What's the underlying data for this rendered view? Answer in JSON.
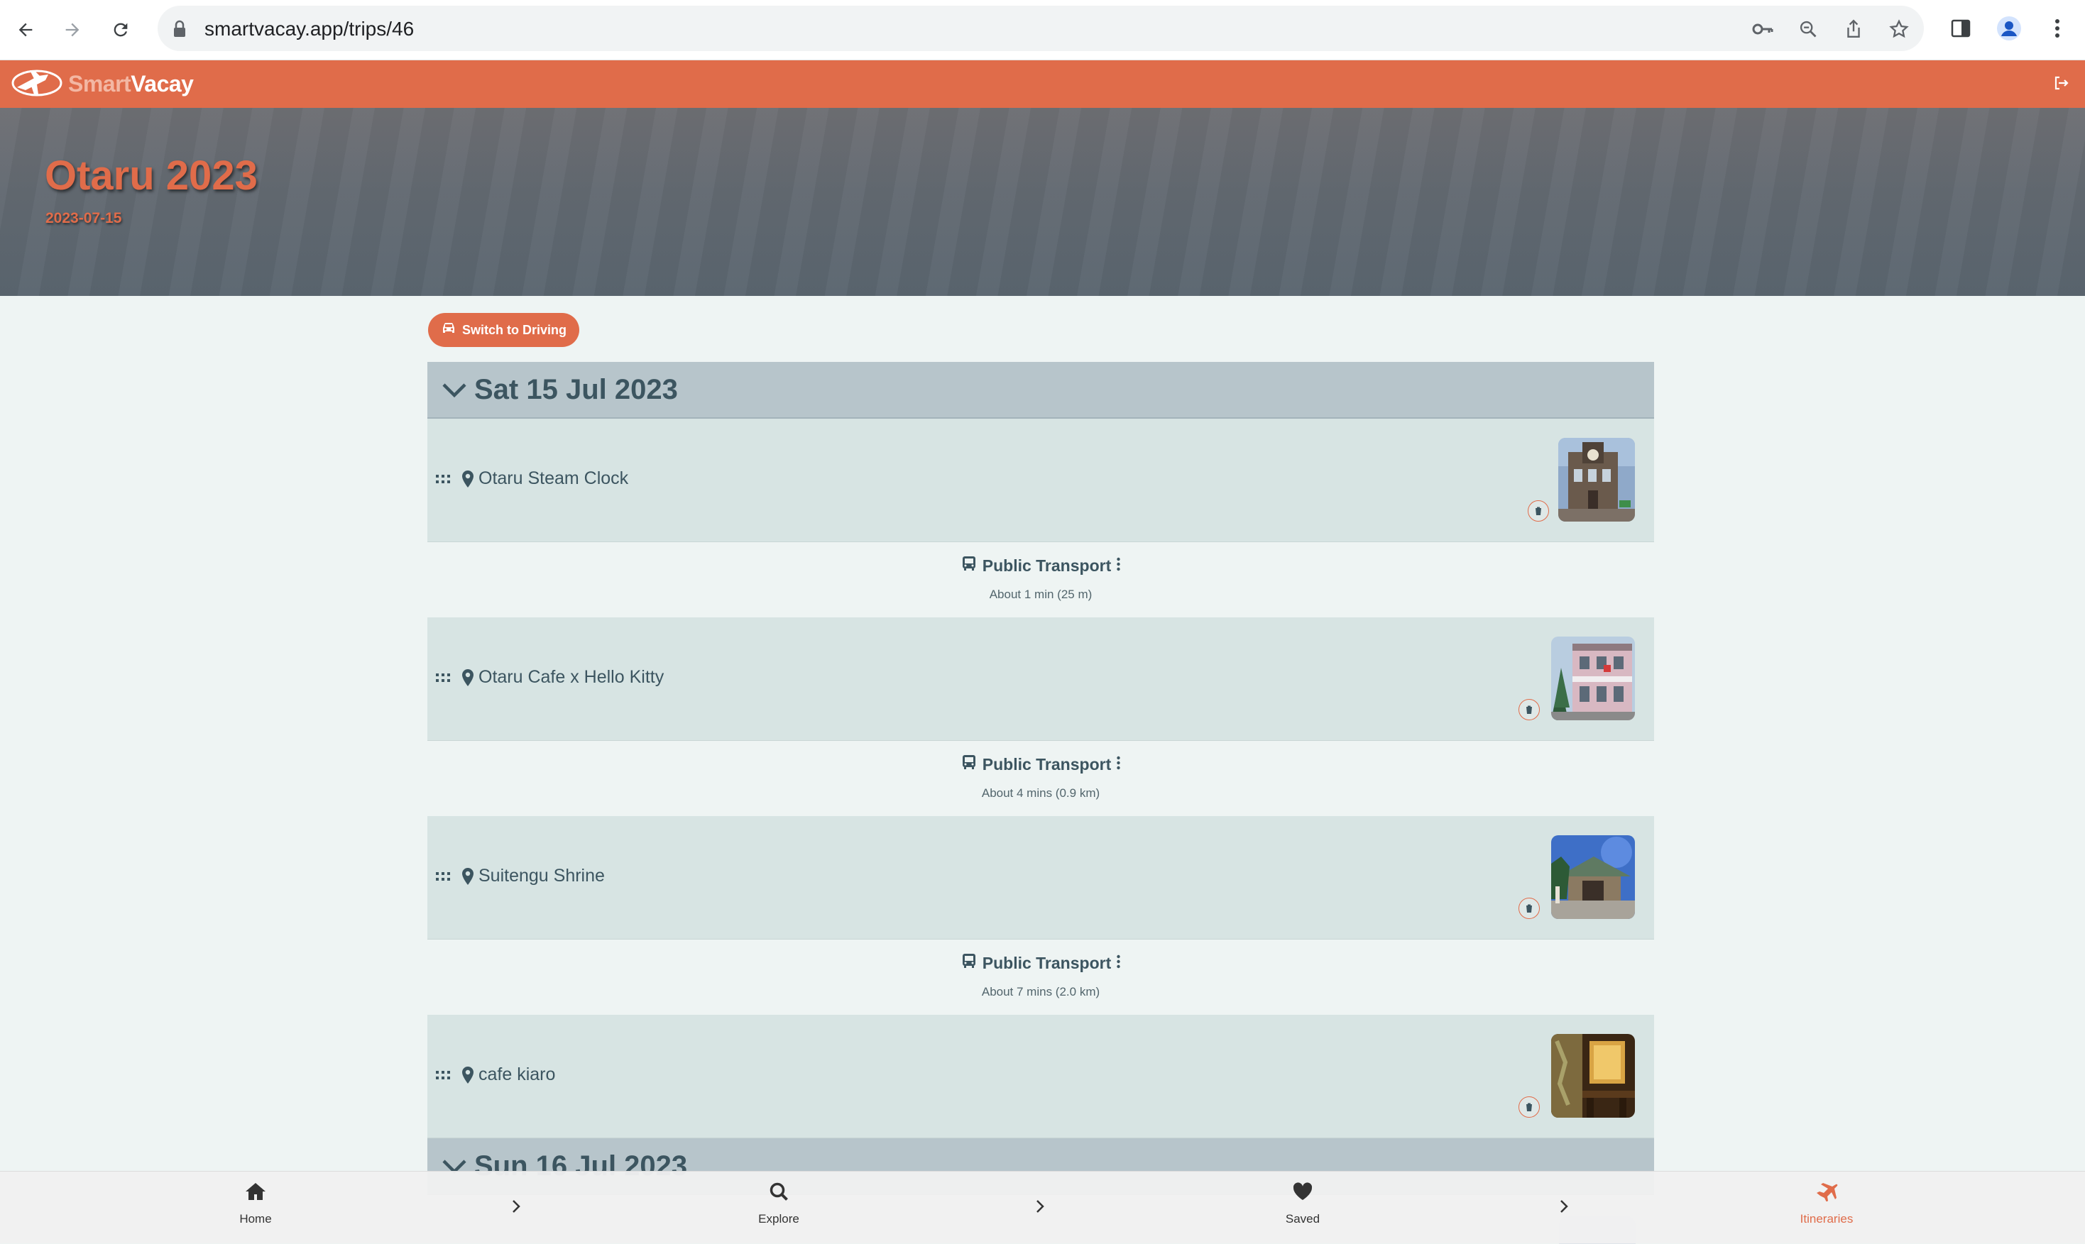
{
  "browser": {
    "url": "smartvacay.app/trips/46"
  },
  "app": {
    "logo_part1": "Smart",
    "logo_part2": "Vacay"
  },
  "trip": {
    "title": "Otaru 2023",
    "date": "2023-07-15"
  },
  "controls": {
    "switch_label": "Switch to Driving"
  },
  "days": [
    {
      "label": "Sat 15 Jul 2023",
      "stops": [
        {
          "name": "Otaru Steam Clock",
          "transit_mode": "Public Transport",
          "transit_duration": "About 1 min (25 m)"
        },
        {
          "name": "Otaru Cafe x Hello Kitty",
          "transit_mode": "Public Transport",
          "transit_duration": "About 4 mins (0.9 km)"
        },
        {
          "name": "Suitengu Shrine",
          "transit_mode": "Public Transport",
          "transit_duration": "About 7 mins (2.0 km)"
        },
        {
          "name": "cafe kiaro"
        }
      ]
    },
    {
      "label": "Sun 16 Jul 2023"
    }
  ],
  "bottom_nav": [
    {
      "label": "Home",
      "icon": "home-icon"
    },
    {
      "label": "Explore",
      "icon": "search-icon"
    },
    {
      "label": "Saved",
      "icon": "heart-icon"
    },
    {
      "label": "Itineraries",
      "icon": "plane-icon",
      "active": true
    }
  ],
  "colors": {
    "brand": "#e06c4a",
    "day_header": "#b7c5cb",
    "stop_bg": "#d7e4e3"
  }
}
